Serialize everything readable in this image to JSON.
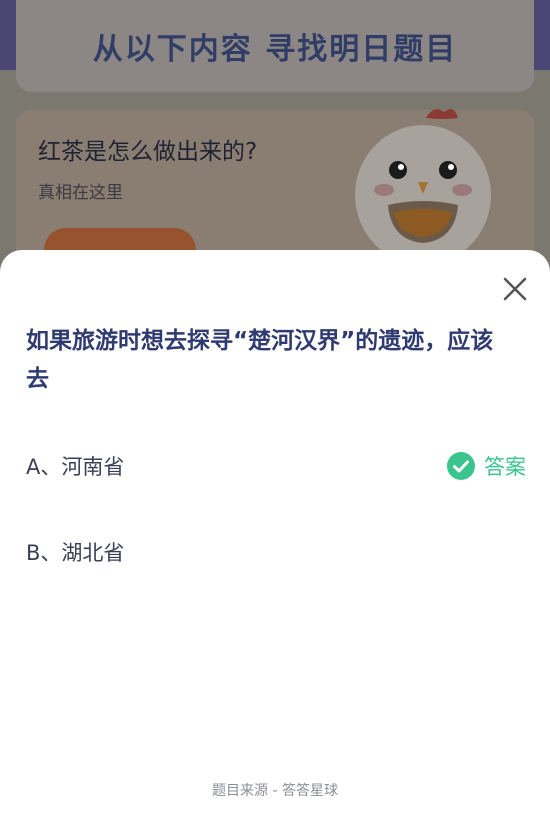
{
  "background": {
    "header_title": "从以下内容 寻找明日题目",
    "card_title": "红茶是怎么做出来的?",
    "card_subtitle": "真相在这里"
  },
  "sheet": {
    "question": "如果旅游时想去探寻“楚河汉界”的遗迹，应该去",
    "options": [
      {
        "label": "A、河南省",
        "is_answer": true
      },
      {
        "label": "B、湖北省",
        "is_answer": false
      }
    ],
    "answer_label": "答案",
    "footer": "题目来源 - 答答星球"
  },
  "colors": {
    "question_text": "#2f3b70",
    "answer_green": "#3bc48d",
    "dim_overlay": "#7c7a7c"
  },
  "icons": [
    "close-icon",
    "check-circle-icon",
    "chicken-mascot-icon"
  ]
}
